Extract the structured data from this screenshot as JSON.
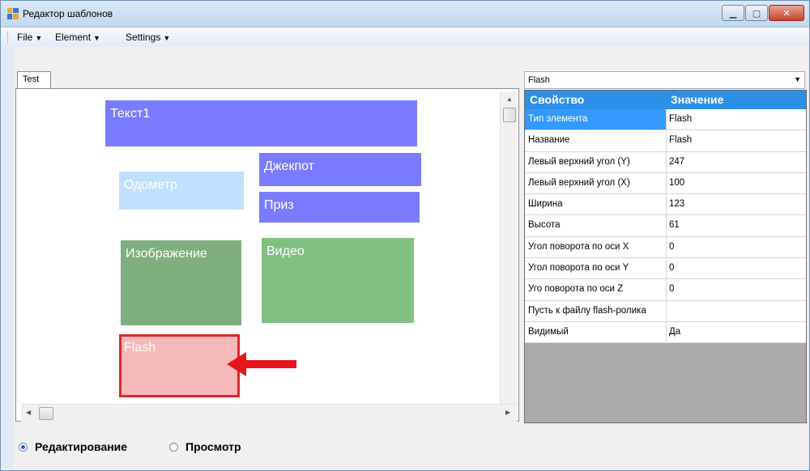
{
  "window": {
    "title": "Редактор шаблонов"
  },
  "menu": {
    "file": "File",
    "element": "Element",
    "settings": "Settings"
  },
  "tabs": [
    {
      "label": "Test"
    }
  ],
  "canvas_elements": [
    {
      "name": "element-text1",
      "label": "Текст1",
      "color": "#7b7bff"
    },
    {
      "name": "element-jackpot",
      "label": "Джекпот",
      "color": "#7b7bff"
    },
    {
      "name": "element-odometer",
      "label": "Одометр",
      "color": "#c1e0ff"
    },
    {
      "name": "element-prize",
      "label": "Приз",
      "color": "#7b7bff"
    },
    {
      "name": "element-image",
      "label": "Изображение",
      "color": "#7fae7f"
    },
    {
      "name": "element-video",
      "label": "Видео",
      "color": "#80c080"
    },
    {
      "name": "element-flash",
      "label": "Flash",
      "color": "#f7baba",
      "selected": true
    }
  ],
  "element_selector": {
    "value": "Flash"
  },
  "properties": {
    "header": {
      "property": "Свойство",
      "value": "Значение"
    },
    "rows": [
      {
        "name": "Тип элемента",
        "value": "Flash",
        "selected": true
      },
      {
        "name": "Название",
        "value": "Flash"
      },
      {
        "name": "Левый верхний угол (Y)",
        "value": "247"
      },
      {
        "name": "Левый верхний угол (X)",
        "value": "100"
      },
      {
        "name": "Ширина",
        "value": "123"
      },
      {
        "name": "Высота",
        "value": "61"
      },
      {
        "name": "Угол поворота по оси X",
        "value": "0"
      },
      {
        "name": "Угол поворота по оси Y",
        "value": "0"
      },
      {
        "name": "Уго поворота по оси Z",
        "value": "0"
      },
      {
        "name": "Пусть к файлу flash-ролика",
        "value": ""
      },
      {
        "name": "Видимый",
        "value": "Да"
      }
    ]
  },
  "mode": {
    "edit": "Редактирование",
    "preview": "Просмотр",
    "selected": "edit"
  },
  "colors": {
    "header_bg": "#2c8fe8",
    "selection": "#3399ff",
    "arrow": "#e8141b",
    "flash_border": "#e0242b"
  }
}
